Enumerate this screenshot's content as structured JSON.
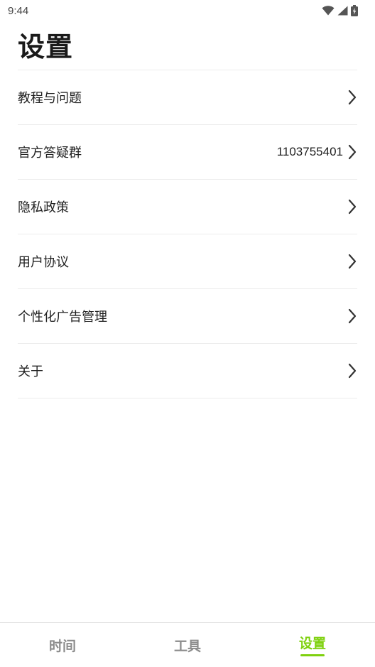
{
  "status_bar": {
    "time": "9:44",
    "icons": [
      "wifi-icon",
      "signal-icon",
      "battery-charging-icon"
    ]
  },
  "page": {
    "title": "设置"
  },
  "settings": {
    "items": [
      {
        "label": "教程与问题",
        "value": ""
      },
      {
        "label": "官方答疑群",
        "value": "1103755401"
      },
      {
        "label": "隐私政策",
        "value": ""
      },
      {
        "label": "用户协议",
        "value": ""
      },
      {
        "label": "个性化广告管理",
        "value": ""
      },
      {
        "label": "关于",
        "value": ""
      }
    ],
    "chevron_icon": "chevron-right-icon"
  },
  "bottom_nav": {
    "tabs": [
      {
        "label": "时间"
      },
      {
        "label": "工具"
      },
      {
        "label": "设置"
      }
    ],
    "active_index": 2,
    "accent_color": "#7fd10f",
    "inactive_color": "#8c8c8c"
  }
}
